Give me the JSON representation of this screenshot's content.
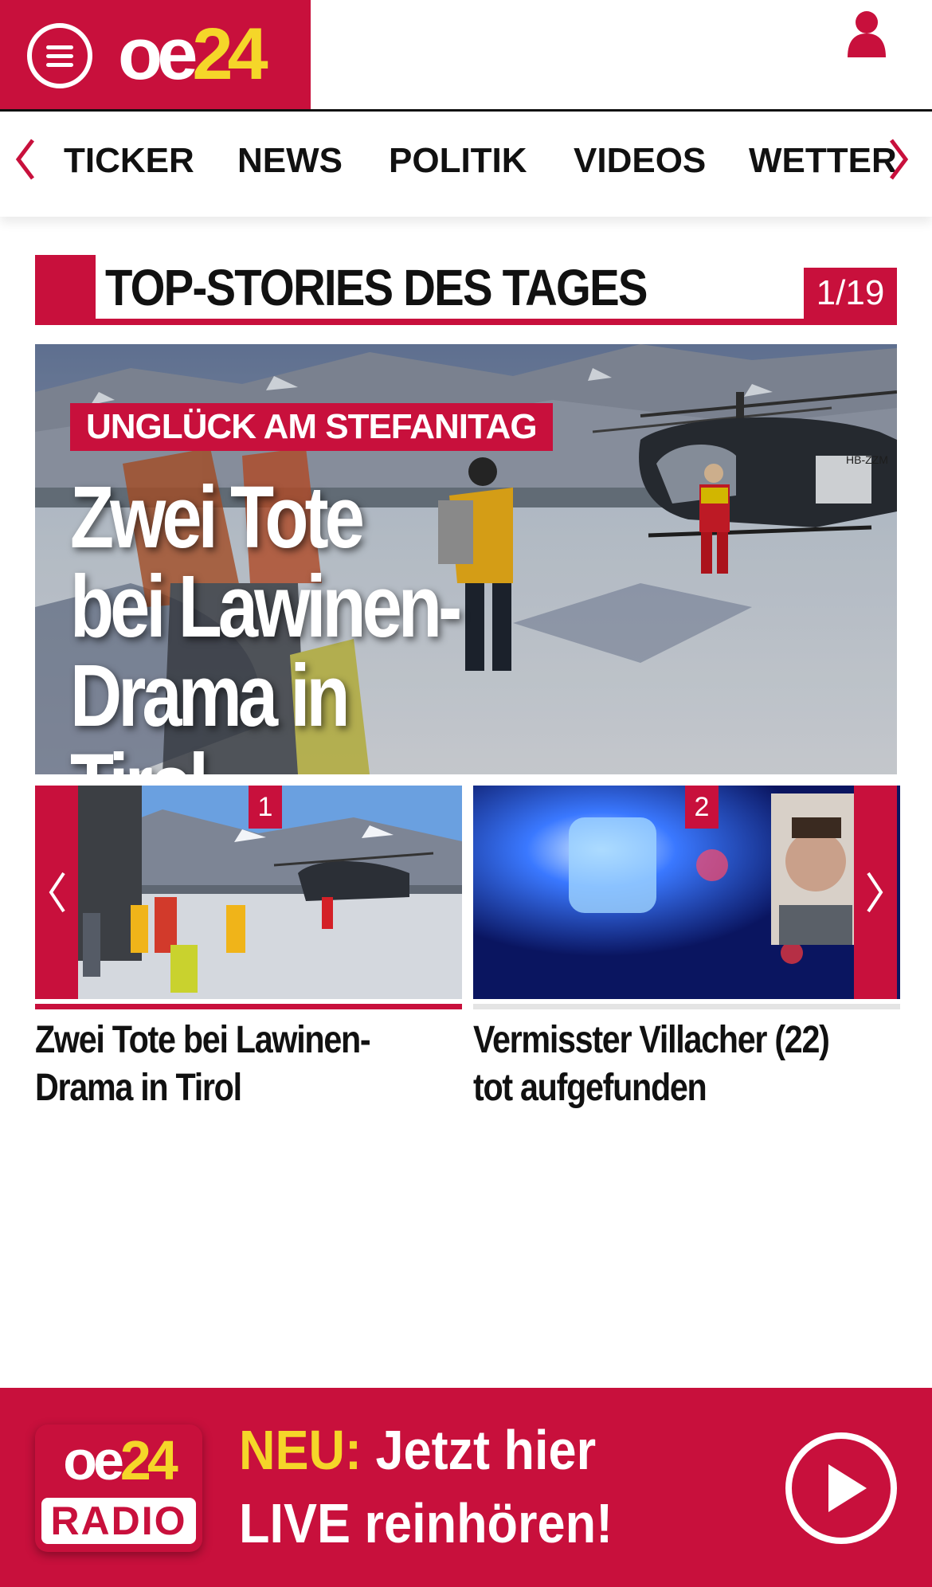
{
  "header": {
    "logo_oe": "oe",
    "logo_num": "24"
  },
  "nav": {
    "items": [
      {
        "label": "TICKER"
      },
      {
        "label": "NEWS"
      },
      {
        "label": "POLITIK"
      },
      {
        "label": "VIDEOS"
      },
      {
        "label": "WETTER"
      }
    ]
  },
  "section": {
    "title": "TOP-STORIES DES TAGES",
    "counter": "1/19"
  },
  "hero": {
    "kicker": "UNGLÜCK AM STEFANITAG",
    "title_line1": "Zwei Tote",
    "title_line2": "bei Lawinen-",
    "title_line3": "Drama in Tirol",
    "helicopter_reg": "HB-ZZM"
  },
  "carousel": {
    "cards": [
      {
        "badge": "1",
        "title": "Zwei Tote bei Lawinen-Drama in Tirol"
      },
      {
        "badge": "2",
        "title": "Vermisster Villacher (22) tot aufgefunden"
      }
    ]
  },
  "radio": {
    "logo_oe": "oe",
    "logo_num": "24",
    "logo_label": "RADIO",
    "neu": "NEU:",
    "line1_rest": " Jetzt hier",
    "line2": "LIVE reinhören!"
  },
  "colors": {
    "brand_red": "#c8103c",
    "brand_yellow": "#f5d629"
  }
}
